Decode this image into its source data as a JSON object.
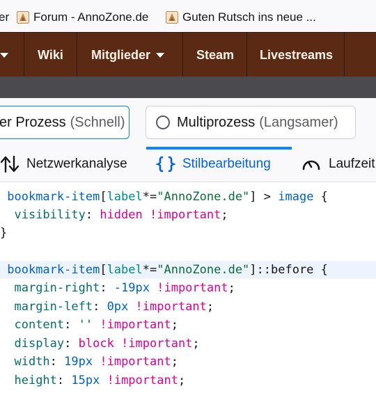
{
  "bookmarks": [
    {
      "label": "er"
    },
    {
      "label": "Forum - AnnoZone.de"
    },
    {
      "label": "Guten Rutsch ins neue ..."
    }
  ],
  "site_nav": {
    "items": [
      {
        "label": "Wiki"
      },
      {
        "label": "Mitglieder"
      },
      {
        "label": "Steam"
      },
      {
        "label": "Livestreams"
      }
    ]
  },
  "process": {
    "option1": {
      "label": "er Prozess",
      "note": "(Schnell)"
    },
    "option2": {
      "label": "Multiprozess",
      "note": "(Langsamer)"
    }
  },
  "devtools_tabs": [
    {
      "label": "Netzwerkanalyse"
    },
    {
      "label": "Stilbearbeitung",
      "active": true
    },
    {
      "label": "Laufzeit"
    }
  ],
  "code": {
    "rule1": {
      "selector": "bookmark-item",
      "attr_name": "label",
      "attr_op": "*=",
      "attr_value": "\"AnnoZone.de\"",
      "combinator": "] > ",
      "target": "image",
      "decls": [
        {
          "prop": "visibility",
          "value": "hidden",
          "important": "!important"
        }
      ]
    },
    "rule2": {
      "selector": "bookmark-item",
      "attr_name": "label",
      "attr_op": "*=",
      "attr_value": "\"AnnoZone.de\"",
      "pseudo": "]::before",
      "decls": [
        {
          "prop": "margin-right",
          "value": "-19px",
          "important": "!important"
        },
        {
          "prop": "margin-left",
          "value": "0px",
          "important": "!important"
        },
        {
          "prop": "content",
          "value": "''",
          "important": "!important"
        },
        {
          "prop": "display",
          "value": "block",
          "important": "!important"
        },
        {
          "prop": "width",
          "value": "19px",
          "important": "!important"
        },
        {
          "prop": "height",
          "value": "15px",
          "important": "!important"
        }
      ]
    }
  }
}
